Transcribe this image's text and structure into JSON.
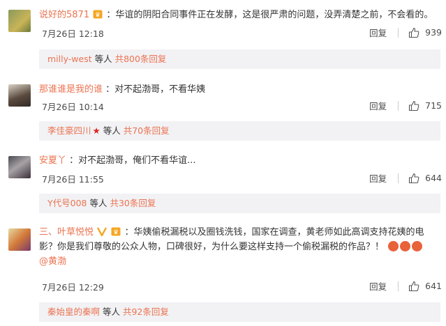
{
  "comments": [
    {
      "username": "说好的5871",
      "text": "：华谊的阴阳合同事件正在发酵，这是很严肃的问题，没弄清楚之前，不会看的。",
      "time": "7月26日 12:18",
      "reply_label": "回复",
      "likes": "939",
      "sub_user": "milly-west",
      "sub_etc": " 等人 ",
      "sub_count": "共800条回复"
    },
    {
      "username": "那谁谁是我的谁",
      "text": "：对不起渤哥，不看华姨",
      "time": "7月26日 10:14",
      "reply_label": "回复",
      "likes": "715",
      "sub_user": "李佳豪四川",
      "sub_etc": " 等人 ",
      "sub_count": "共70条回复"
    },
    {
      "username": "安夏丫",
      "text": "：对不起渤哥，俺们不看华谊...",
      "time": "7月26日 11:55",
      "reply_label": "回复",
      "likes": "644",
      "sub_user": "Y代号008",
      "sub_etc": " 等人 ",
      "sub_count": "共30条回复"
    },
    {
      "username": "三、叶草悦悦",
      "text": "：华姨偷税漏税以及圈钱洗钱，国家在调查，黄老师如此高调支持花姨的电影？你是我们尊敬的公众人物，口碑很好，为什么要这样支持一个偷税漏税的作品？！",
      "mention": "@黄渤",
      "time": "7月26日 12:29",
      "reply_label": "回复",
      "likes": "641",
      "sub_user": "秦始皇的秦啊",
      "sub_etc": " 等人 ",
      "sub_count": "共92条回复"
    }
  ],
  "colors": {
    "name": "#eb7350",
    "badge": "#f5a623",
    "subbg": "#f2f2f5"
  }
}
